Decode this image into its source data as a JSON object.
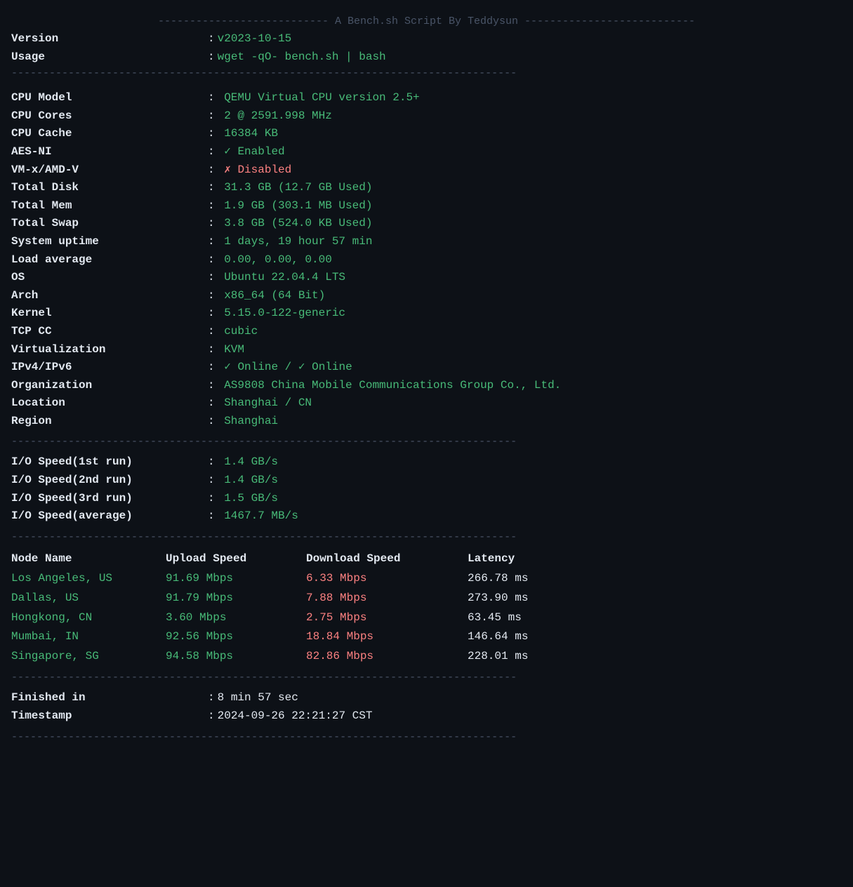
{
  "banner": {
    "divider_top": "--------------------------- A Bench.sh Script By Teddysun ---------------------------",
    "version_label": "Version",
    "version_value": "v2023-10-15",
    "usage_label": "Usage",
    "usage_value": "wget -qO- bench.sh | bash",
    "divider_bottom": "--------------------------------------------------------------------------------"
  },
  "system": {
    "divider": "--------------------------------------------------------------------------------",
    "rows": [
      {
        "label": "CPU Model",
        "value": "QEMU Virtual CPU version 2.5+",
        "color": "green"
      },
      {
        "label": "CPU Cores",
        "value": "2 @ 2591.998 MHz",
        "color": "green"
      },
      {
        "label": "CPU Cache",
        "value": "16384 KB",
        "color": "green"
      },
      {
        "label": "AES-NI",
        "value": "✓ Enabled",
        "color": "green"
      },
      {
        "label": "VM-x/AMD-V",
        "value": "✗ Disabled",
        "color": "red"
      },
      {
        "label": "Total Disk",
        "value": "31.3 GB (12.7 GB Used)",
        "color": "green"
      },
      {
        "label": "Total Mem",
        "value": "1.9 GB (303.1 MB Used)",
        "color": "green"
      },
      {
        "label": "Total Swap",
        "value": "3.8 GB (524.0 KB Used)",
        "color": "green"
      },
      {
        "label": "System uptime",
        "value": "1 days, 19 hour 57 min",
        "color": "green"
      },
      {
        "label": "Load average",
        "value": "0.00, 0.00, 0.00",
        "color": "green"
      },
      {
        "label": "OS",
        "value": "Ubuntu 22.04.4 LTS",
        "color": "green"
      },
      {
        "label": "Arch",
        "value": "x86_64 (64 Bit)",
        "color": "green"
      },
      {
        "label": "Kernel",
        "value": "5.15.0-122-generic",
        "color": "green"
      },
      {
        "label": "TCP CC",
        "value": "cubic",
        "color": "green"
      },
      {
        "label": "Virtualization",
        "value": "KVM",
        "color": "green"
      },
      {
        "label": "IPv4/IPv6",
        "value": "✓ Online / ✓ Online",
        "color": "green"
      },
      {
        "label": "Organization",
        "value": "AS9808 China Mobile Communications Group Co., Ltd.",
        "color": "green"
      },
      {
        "label": "Location",
        "value": "Shanghai / CN",
        "color": "green"
      },
      {
        "label": "Region",
        "value": "Shanghai",
        "color": "green"
      }
    ]
  },
  "io": {
    "divider": "--------------------------------------------------------------------------------",
    "rows": [
      {
        "label": "I/O Speed(1st run)",
        "value": "1.4 GB/s"
      },
      {
        "label": "I/O Speed(2nd run)",
        "value": "1.4 GB/s"
      },
      {
        "label": "I/O Speed(3rd run)",
        "value": "1.5 GB/s"
      },
      {
        "label": "I/O Speed(average)",
        "value": "1467.7 MB/s"
      }
    ]
  },
  "network": {
    "divider": "--------------------------------------------------------------------------------",
    "header": {
      "node": "Node Name",
      "upload": "Upload Speed",
      "download": "Download Speed",
      "latency": "Latency"
    },
    "rows": [
      {
        "node": "Los Angeles, US",
        "upload": "91.69 Mbps",
        "download": "6.33 Mbps",
        "latency": "266.78 ms"
      },
      {
        "node": "Dallas, US",
        "upload": "91.79 Mbps",
        "download": "7.88 Mbps",
        "latency": "273.90 ms"
      },
      {
        "node": "Hongkong, CN",
        "upload": "3.60 Mbps",
        "download": "2.75 Mbps",
        "latency": "63.45 ms"
      },
      {
        "node": "Mumbai, IN",
        "upload": "92.56 Mbps",
        "download": "18.84 Mbps",
        "latency": "146.64 ms"
      },
      {
        "node": "Singapore, SG",
        "upload": "94.58 Mbps",
        "download": "82.86 Mbps",
        "latency": "228.01 ms"
      }
    ]
  },
  "footer": {
    "divider": "--------------------------------------------------------------------------------",
    "finished_label": "Finished in",
    "finished_value": "8 min 57 sec",
    "timestamp_label": "Timestamp",
    "timestamp_value": "2024-09-26 22:21:27 CST",
    "divider2": "--------------------------------------------------------------------------------"
  }
}
